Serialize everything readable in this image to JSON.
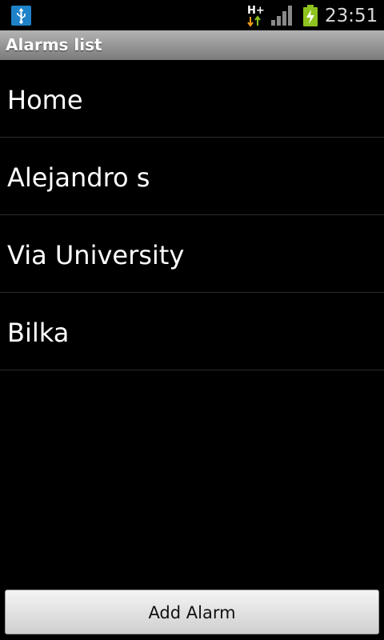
{
  "status_bar": {
    "time": "23:51",
    "network_label": "H+",
    "icons": [
      "usb-icon",
      "network-activity-icon",
      "signal-icon",
      "battery-charging-icon"
    ]
  },
  "title_bar": {
    "title": "Alarms list"
  },
  "alarms": [
    {
      "label": "Home"
    },
    {
      "label": "Alejandro s"
    },
    {
      "label": "Via University"
    },
    {
      "label": "Bilka"
    }
  ],
  "footer": {
    "add_button_label": "Add Alarm"
  },
  "colors": {
    "background": "#000000",
    "title_bar_gradient_top": "#b3b3b3",
    "title_bar_gradient_bottom": "#7b7b7b",
    "usb_icon": "#1f82c9",
    "battery_charging": "#8ec31f"
  }
}
